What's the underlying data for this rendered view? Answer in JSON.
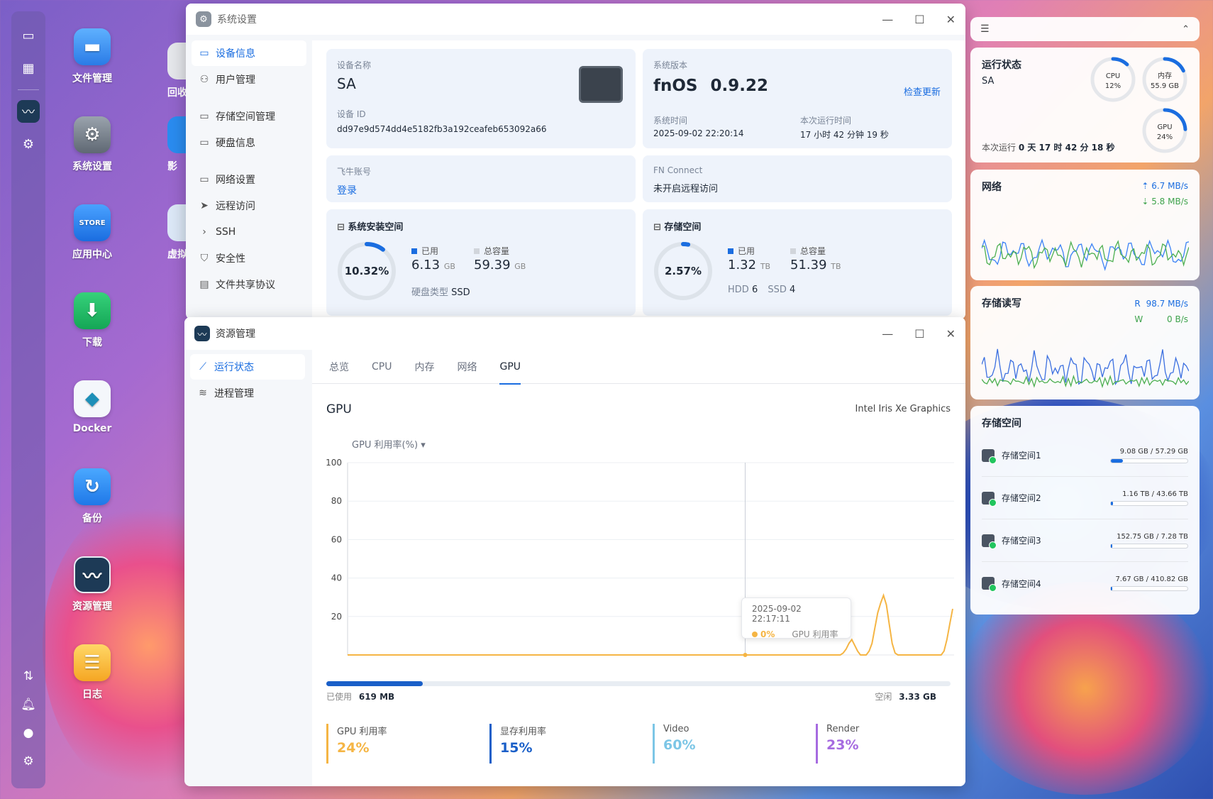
{
  "desktop": {
    "icons": [
      {
        "label": "文件管理"
      },
      {
        "label": "系统设置"
      },
      {
        "label": "应用中心"
      },
      {
        "label": "下载"
      },
      {
        "label": "Docker"
      },
      {
        "label": "备份"
      },
      {
        "label": "资源管理"
      },
      {
        "label": "日志"
      }
    ],
    "partial_icons": [
      {
        "label": "回收"
      },
      {
        "label": "影"
      },
      {
        "label": "虚拟"
      }
    ]
  },
  "settings": {
    "title": "系统设置",
    "nav": [
      "设备信息",
      "用户管理",
      "存储空间管理",
      "硬盘信息",
      "网络设置",
      "远程访问",
      "SSH",
      "安全性",
      "文件共享协议"
    ],
    "device_name_label": "设备名称",
    "device_name": "SA",
    "device_id_label": "设备 ID",
    "device_id": "dd97e9d574dd4e5182fb3a192ceafeb653092a66",
    "os_version_label": "系统版本",
    "os_name": "fnOS",
    "os_version": "0.9.22",
    "check_update": "检查更新",
    "sys_time_label": "系统时间",
    "sys_time": "2025-09-02 22:20:14",
    "uptime_label": "本次运行时间",
    "uptime": "17 小时 42 分钟 19 秒",
    "fei_label": "飞牛账号",
    "login": "登录",
    "fnconnect_label": "FN Connect",
    "fnconnect_value": "未开启远程访问",
    "sys_space_title": "系统安装空间",
    "sys_space_pct": "10.32%",
    "sys_space_fraction": 0.1032,
    "used_label": "已用",
    "total_label": "总容量",
    "sys_used_val": "6.13",
    "sys_used_unit": "GB",
    "sys_total_val": "59.39",
    "sys_total_unit": "GB",
    "disk_type_label": "硬盘类型",
    "disk_type": "SSD",
    "storage_title": "存储空间",
    "storage_pct": "2.57%",
    "storage_fraction": 0.0257,
    "st_used_val": "1.32",
    "st_used_unit": "TB",
    "st_total_val": "51.39",
    "st_total_unit": "TB",
    "hdd_label": "HDD",
    "hdd_count": "6",
    "ssd_label": "SSD",
    "ssd_count": "4"
  },
  "resmon": {
    "title": "资源管理",
    "nav": [
      "运行状态",
      "进程管理"
    ],
    "tabs": [
      "总览",
      "CPU",
      "内存",
      "网络",
      "GPU"
    ],
    "selected_tab": "GPU",
    "gpu_heading": "GPU",
    "gpu_model": "Intel Iris Xe Graphics",
    "metric_select": "GPU 利用率(%)",
    "tooltip_time": "2025-09-02 22:17:11",
    "tooltip_val": "0%",
    "tooltip_series": "GPU 利用率",
    "mem_used_label": "已使用",
    "mem_used": "619 MB",
    "mem_free_label": "空闲",
    "mem_free": "3.33 GB",
    "mem_fraction": 0.154,
    "stats": [
      {
        "label": "GPU 利用率",
        "value": "24%",
        "color": "#f5b544"
      },
      {
        "label": "显存利用率",
        "value": "15%",
        "color": "#1a5fc8"
      },
      {
        "label": "Video",
        "value": "60%",
        "color": "#7cc6e6"
      },
      {
        "label": "Render",
        "value": "23%",
        "color": "#a66be0"
      }
    ]
  },
  "chart_data": {
    "type": "line",
    "yticks": [
      "100",
      "80",
      "60",
      "40",
      "20"
    ],
    "ylim": [
      0,
      100
    ],
    "series": [
      {
        "color": "#f5b544",
        "values": [
          0,
          0,
          0,
          0,
          0,
          0,
          0,
          0,
          0,
          0,
          0,
          0,
          0,
          0,
          0,
          0,
          0,
          0,
          0,
          0,
          0,
          0,
          0,
          0,
          0,
          0,
          0,
          0,
          0,
          0,
          0,
          0,
          0,
          0,
          0,
          0,
          0,
          0,
          0,
          0,
          0,
          0,
          0,
          0,
          0,
          0,
          0,
          0,
          0,
          0,
          0,
          0,
          0,
          0,
          0,
          0,
          0,
          0,
          0,
          0,
          0,
          0,
          0,
          0,
          0,
          0,
          0,
          0,
          0,
          0,
          0,
          0,
          0,
          0,
          0,
          0,
          0,
          0,
          0,
          0,
          0,
          0,
          0,
          0,
          0,
          0,
          0,
          0,
          0,
          0,
          0,
          0,
          0,
          0,
          0,
          0,
          0,
          0,
          0,
          0,
          0,
          0,
          0,
          0,
          0,
          0,
          0,
          0,
          0,
          0,
          0,
          0,
          0,
          0,
          0,
          0,
          0,
          0,
          0,
          0,
          0,
          0,
          0,
          0,
          0,
          0,
          0,
          0,
          0,
          0,
          0,
          0,
          0,
          0,
          0,
          0,
          0,
          0,
          0,
          0,
          0,
          0,
          0,
          0,
          0,
          0,
          0,
          0,
          0,
          0,
          0,
          0,
          0,
          0,
          0,
          0,
          0,
          0,
          0,
          0,
          0,
          0,
          0,
          0,
          0,
          0,
          0,
          0,
          0,
          0,
          0,
          0,
          1,
          3,
          6,
          8,
          5,
          2,
          0,
          0,
          0,
          2,
          6,
          14,
          22,
          27,
          31,
          26,
          16,
          6,
          1,
          0,
          0,
          0,
          0,
          0,
          0,
          0,
          0,
          0,
          0,
          0,
          0,
          0,
          0,
          0,
          0,
          2,
          8,
          16,
          24
        ]
      }
    ]
  },
  "widgets": {
    "status_title": "运行状态",
    "host": "SA",
    "cpu_label": "CPU",
    "cpu_val": "12%",
    "cpu_frac": 0.12,
    "mem_label": "内存",
    "mem_val": "55.9 GB",
    "mem_frac": 0.18,
    "gpu_label": "GPU",
    "gpu_val": "24%",
    "gpu_frac": 0.24,
    "uptime_prefix": "本次运行",
    "uptime": "0 天 17 时 42 分 18 秒",
    "net_title": "网络",
    "net_up": "6.7 MB/s",
    "net_down": "5.8 MB/s",
    "io_title": "存储读写",
    "io_r_label": "R",
    "io_r": "98.7 MB/s",
    "io_w_label": "W",
    "io_w": "0 B/s",
    "storage_title": "存储空间",
    "volumes": [
      {
        "name": "存储空间1",
        "usage": "9.08 GB / 57.29 GB",
        "frac": 0.158
      },
      {
        "name": "存储空间2",
        "usage": "1.16 TB / 43.66 TB",
        "frac": 0.027
      },
      {
        "name": "存储空间3",
        "usage": "152.75 GB / 7.28 TB",
        "frac": 0.02
      },
      {
        "name": "存储空间4",
        "usage": "7.67 GB / 410.82 GB",
        "frac": 0.019
      }
    ]
  }
}
